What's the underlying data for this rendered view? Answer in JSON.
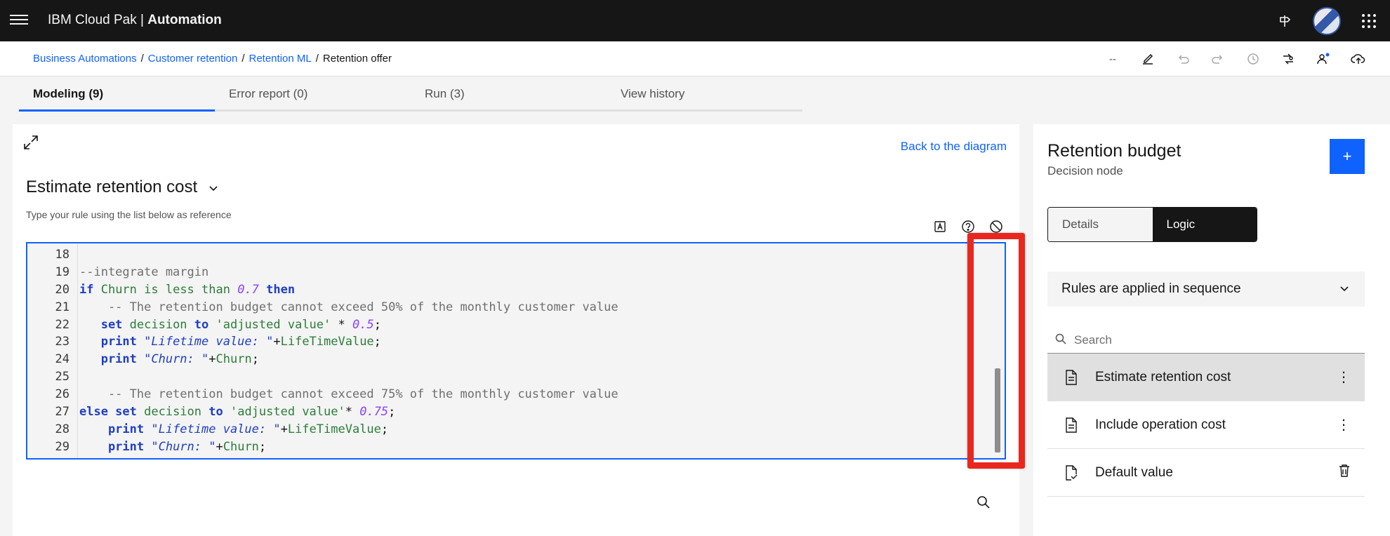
{
  "header": {
    "brand_prefix": "IBM Cloud Pak | ",
    "brand_bold": "Automation"
  },
  "breadcrumb": [
    {
      "label": "Business Automations",
      "link": true
    },
    {
      "label": "Customer retention",
      "link": true
    },
    {
      "label": "Retention ML",
      "link": true
    },
    {
      "label": "Retention offer",
      "link": false
    }
  ],
  "toolbar": {
    "dash_label": "--"
  },
  "tabs": [
    {
      "label": "Modeling (9)",
      "active": true
    },
    {
      "label": "Error report (0)",
      "active": false
    },
    {
      "label": "Run (3)",
      "active": false
    },
    {
      "label": "View history",
      "active": false
    }
  ],
  "editor": {
    "back_link": "Back to the diagram",
    "rule_name": "Estimate retention cost",
    "hint": "Type your rule using the list below as reference",
    "lines": [
      {
        "n": "18",
        "tokens": []
      },
      {
        "n": "19",
        "tokens": [
          {
            "t": "--integrate margin",
            "c": "cm"
          }
        ]
      },
      {
        "n": "20",
        "tokens": [
          {
            "t": "if ",
            "c": "kw"
          },
          {
            "t": "Churn",
            "c": "var"
          },
          {
            "t": " is less than ",
            "c": "var"
          },
          {
            "t": "0.7",
            "c": "num"
          },
          {
            "t": " then",
            "c": "kw"
          }
        ]
      },
      {
        "n": "21",
        "tokens": [
          {
            "t": "    -- The retention budget cannot exceed 50% of the monthly customer value",
            "c": "cm"
          }
        ]
      },
      {
        "n": "22",
        "tokens": [
          {
            "t": "   set ",
            "c": "kw"
          },
          {
            "t": "decision",
            "c": "var"
          },
          {
            "t": " to ",
            "c": "kw"
          },
          {
            "t": "'adjusted value'",
            "c": "str"
          },
          {
            "t": " * ",
            "c": "plain"
          },
          {
            "t": "0.5",
            "c": "num"
          },
          {
            "t": ";",
            "c": "plain"
          }
        ]
      },
      {
        "n": "23",
        "tokens": [
          {
            "t": "   print ",
            "c": "kw"
          },
          {
            "t": "\"Lifetime value: \"",
            "c": "istr"
          },
          {
            "t": "+",
            "c": "plain"
          },
          {
            "t": "LifeTimeValue",
            "c": "var"
          },
          {
            "t": ";",
            "c": "plain"
          }
        ]
      },
      {
        "n": "24",
        "tokens": [
          {
            "t": "   print ",
            "c": "kw"
          },
          {
            "t": "\"Churn: \"",
            "c": "istr"
          },
          {
            "t": "+",
            "c": "plain"
          },
          {
            "t": "Churn",
            "c": "var"
          },
          {
            "t": ";",
            "c": "plain"
          }
        ]
      },
      {
        "n": "25",
        "tokens": []
      },
      {
        "n": "26",
        "tokens": [
          {
            "t": "    -- The retention budget cannot exceed 75% of the monthly customer value",
            "c": "cm"
          }
        ]
      },
      {
        "n": "27",
        "tokens": [
          {
            "t": "else set ",
            "c": "kw"
          },
          {
            "t": "decision",
            "c": "var"
          },
          {
            "t": " to ",
            "c": "kw"
          },
          {
            "t": "'adjusted value'",
            "c": "str"
          },
          {
            "t": "* ",
            "c": "plain"
          },
          {
            "t": "0.75",
            "c": "num"
          },
          {
            "t": ";",
            "c": "plain"
          }
        ]
      },
      {
        "n": "28",
        "tokens": [
          {
            "t": "    print ",
            "c": "kw"
          },
          {
            "t": "\"Lifetime value: \"",
            "c": "istr"
          },
          {
            "t": "+",
            "c": "plain"
          },
          {
            "t": "LifeTimeValue",
            "c": "var"
          },
          {
            "t": ";",
            "c": "plain"
          }
        ]
      },
      {
        "n": "29",
        "tokens": [
          {
            "t": "    print ",
            "c": "kw"
          },
          {
            "t": "\"Churn: \"",
            "c": "istr"
          },
          {
            "t": "+",
            "c": "plain"
          },
          {
            "t": "Churn",
            "c": "var"
          },
          {
            "t": ";",
            "c": "plain"
          }
        ]
      }
    ]
  },
  "right_panel": {
    "title": "Retention budget",
    "subtitle": "Decision node",
    "add_label": "+",
    "switch": {
      "details": "Details",
      "logic": "Logic"
    },
    "sequence_label": "Rules are applied in sequence",
    "search_placeholder": "Search",
    "rules": [
      {
        "label": "Estimate retention cost",
        "icon": "document-icon",
        "action": "overflow-menu",
        "selected": true
      },
      {
        "label": "Include operation cost",
        "icon": "document-icon",
        "action": "overflow-menu",
        "selected": false
      },
      {
        "label": "Default value",
        "icon": "document-check-icon",
        "action": "delete",
        "selected": false
      }
    ]
  },
  "colors": {
    "accent": "#0f62fe",
    "highlight": "#e8281f",
    "header_bg": "#161616"
  }
}
